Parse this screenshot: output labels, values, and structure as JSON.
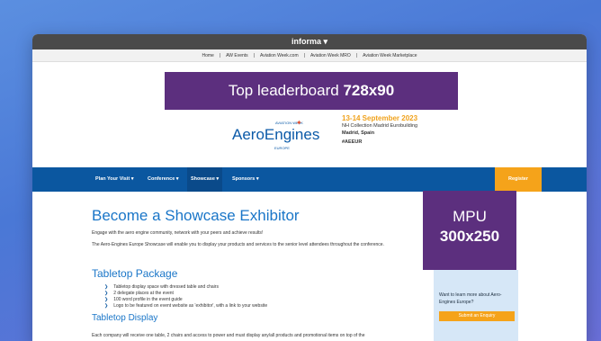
{
  "topbar": {
    "brand": "informa ▾"
  },
  "toplinks": [
    "Home",
    "|",
    "AW Events",
    "|",
    "Aviation Week.com",
    "|",
    "Aviation Week MRO",
    "|",
    "Aviation Week Marketplace"
  ],
  "ads": {
    "leaderboard_text": "Top leaderboard",
    "leaderboard_size": "728x90",
    "mpu_text": "MPU",
    "mpu_size": "300x250"
  },
  "logo": {
    "text": "AeroEngines",
    "sub": "AVIATION WEEK",
    "region": "EUROPE"
  },
  "event": {
    "date": "13-14 September 2023",
    "venue": "NH Collection Madrid Eurobuilding",
    "city": "Madrid, Spain",
    "hashtag": "#AEEUR"
  },
  "nav": {
    "items": [
      "Plan Your Visit ▾",
      "Conference ▾",
      "Showcase ▾",
      "Sponsors ▾"
    ],
    "register": "Register"
  },
  "content": {
    "title": "Become a Showcase Exhibitor",
    "intro": "Engage with the aero engine community, network with your peers and achieve results!",
    "body": "The Aero-Engines Europe Showcase will enable you to display your products and services to the senior level attendees throughout the conference.",
    "tabletop_package_heading": "Tabletop Package",
    "bullets": [
      "Tabletop display space with dressed table and chairs",
      "2 delegate places at the event",
      "100 word profile in the event guide",
      "Logo to be featured on event website as 'exhibitor', with a link to your website"
    ],
    "tabletop_display_heading": "Tabletop Display",
    "display_text": "Each company will receive one table, 2 chairs and access to power and must display any/all products and promotional items on top of the"
  },
  "sidebox": {
    "text": "Want to learn more about Aero-Engines Europe?",
    "button": "Submit an Enquiry"
  }
}
